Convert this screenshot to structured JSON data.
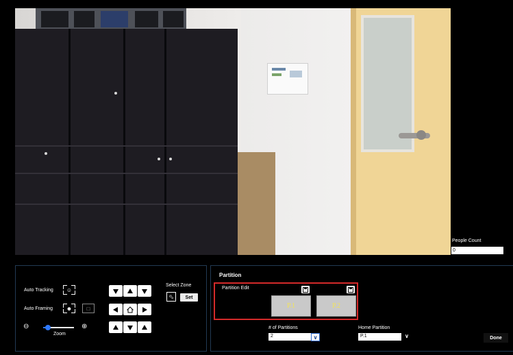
{
  "video": {
    "name": "camera-live-view"
  },
  "people_count": {
    "label": "People Count",
    "value": "0"
  },
  "ptz": {
    "auto_tracking_label": "Auto Tracking",
    "auto_framing_label": "Auto Framing",
    "zoom_label": "Zoom",
    "zoom_level": 0.15,
    "select_zone_label": "Select Zone",
    "set_label": "Set",
    "accent": "#2f79ff"
  },
  "partition": {
    "title": "Partition",
    "edit_label": "Partition Edit",
    "tiles": [
      {
        "label": "P.1"
      },
      {
        "label": "P.2"
      }
    ],
    "num_partitions_label": "# of Partitions",
    "num_partitions_value": "2",
    "home_partition_label": "Home Partition",
    "home_partition_value": "P.1",
    "done_label": "Done",
    "highlight_color": "#d42a2a"
  }
}
